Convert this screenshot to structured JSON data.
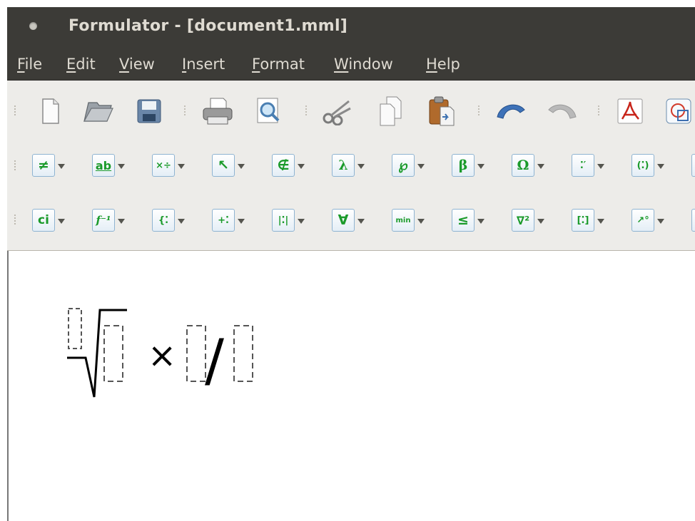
{
  "window": {
    "title": "Formulator - [document1.mml]"
  },
  "menubar": {
    "items": [
      {
        "label": "File",
        "accel": "F",
        "rest": "ile"
      },
      {
        "label": "Edit",
        "accel": "E",
        "rest": "dit"
      },
      {
        "label": "View",
        "accel": "V",
        "rest": "iew"
      },
      {
        "label": "Insert",
        "accel": "I",
        "rest": "nsert"
      },
      {
        "label": "Format",
        "accel": "F",
        "rest": "ormat"
      },
      {
        "label": "Window",
        "accel": "W",
        "rest": "indow"
      },
      {
        "label": "Help",
        "accel": "H",
        "rest": "elp"
      }
    ]
  },
  "toolbar_main": {
    "icons": [
      "new-document-icon",
      "open-folder-icon",
      "save-icon",
      "print-icon",
      "print-preview-icon",
      "cut-icon",
      "copy-icon",
      "paste-icon",
      "undo-icon",
      "redo-icon",
      "export-pdf-icon",
      "export-image-icon"
    ]
  },
  "palette_row1": {
    "buttons": [
      {
        "name": "relations-palette",
        "glyph": "≠"
      },
      {
        "name": "decorations-palette",
        "glyph": "ab"
      },
      {
        "name": "operators-palette",
        "glyph": "×÷"
      },
      {
        "name": "arrows-palette",
        "glyph": "↖"
      },
      {
        "name": "set-relations-palette",
        "glyph": "∉"
      },
      {
        "name": "lambda-palette",
        "glyph": "λ"
      },
      {
        "name": "misc-symbols-palette",
        "glyph": "℘"
      },
      {
        "name": "greek-lowercase-palette",
        "glyph": "β"
      },
      {
        "name": "greek-uppercase-palette",
        "glyph": "Ω"
      },
      {
        "name": "primes-palette",
        "glyph": "⁚′"
      },
      {
        "name": "brackets-palette",
        "glyph": "(⁚)"
      }
    ]
  },
  "palette_row2": {
    "buttons": [
      {
        "name": "content-identifier-palette",
        "glyph": "ci"
      },
      {
        "name": "functions-palette",
        "glyph": "f⁻¹"
      },
      {
        "name": "set-palette",
        "glyph": "{⁚"
      },
      {
        "name": "arithmetic-palette",
        "glyph": "+⁚"
      },
      {
        "name": "absolute-value-palette",
        "glyph": "|⁚|"
      },
      {
        "name": "logic-palette",
        "glyph": "∀"
      },
      {
        "name": "limits-palette",
        "glyph": "min"
      },
      {
        "name": "inequalities-palette",
        "glyph": "≤"
      },
      {
        "name": "calculus-palette",
        "glyph": "∇²"
      },
      {
        "name": "determinant-palette",
        "glyph": "[⁚]"
      },
      {
        "name": "vectors-palette",
        "glyph": "↗°"
      }
    ]
  },
  "document": {
    "formula_operator": "×",
    "formula_slash": "/"
  },
  "colors": {
    "titlebar_bg": "#3c3b37",
    "titlebar_text": "#dfdbd2",
    "toolbar_bg": "#edece9",
    "palette_glyph": "#1a9a2a",
    "palette_border": "#8fb4d2"
  }
}
